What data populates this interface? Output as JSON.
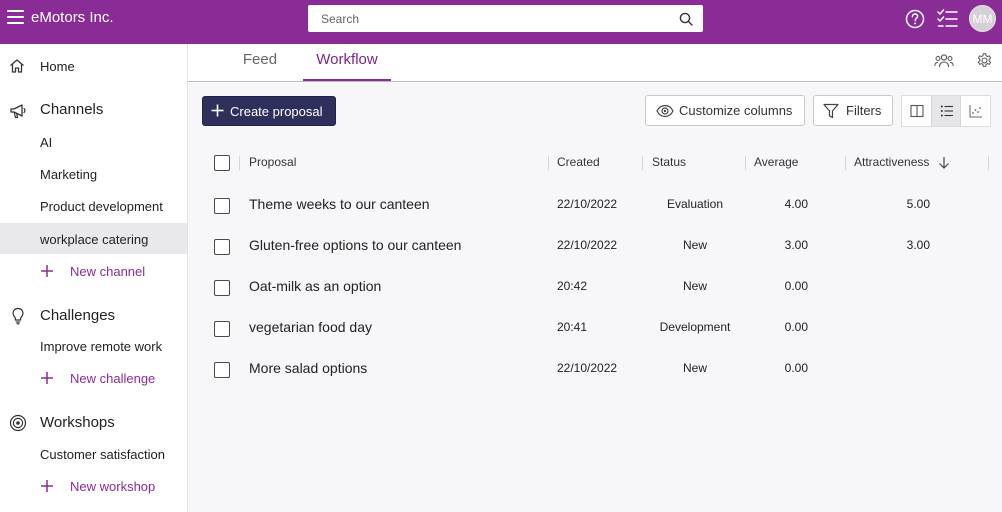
{
  "app": {
    "title": "eMotors Inc."
  },
  "search": {
    "placeholder": "Search"
  },
  "user": {
    "initials": "MM"
  },
  "colors": {
    "brand": "#8a2c96",
    "primary_button": "#2f2f5c",
    "active_tab": "#7b2584",
    "content_bg": "#f7f7f9"
  },
  "sidebar": {
    "home": "Home",
    "channels_title": "Channels",
    "channels": [
      "AI",
      "Marketing",
      "Product development",
      "workplace catering"
    ],
    "active_channel": "workplace catering",
    "new_channel": "New channel",
    "challenges_title": "Challenges",
    "challenges": [
      "Improve remote work"
    ],
    "new_challenge": "New challenge",
    "workshops_title": "Workshops",
    "workshops": [
      "Customer satisfaction"
    ],
    "new_workshop": "New workshop"
  },
  "tabs": [
    {
      "label": "Feed",
      "active": false
    },
    {
      "label": "Workflow",
      "active": true
    }
  ],
  "toolbar": {
    "create_label": "Create proposal",
    "customize_label": "Customize columns",
    "filters_label": "Filters",
    "active_view": "list"
  },
  "table": {
    "columns": {
      "proposal": "Proposal",
      "created": "Created",
      "status": "Status",
      "average": "Average",
      "attractiveness": "Attractiveness"
    },
    "sort": {
      "column": "attractiveness",
      "direction": "descending"
    },
    "rows": [
      {
        "proposal": "Theme weeks to our canteen",
        "created": "22/10/2022",
        "status": "Evaluation",
        "average": "4.00",
        "attractiveness": "5.00"
      },
      {
        "proposal": "Gluten-free options to our canteen",
        "created": "22/10/2022",
        "status": "New",
        "average": "3.00",
        "attractiveness": "3.00"
      },
      {
        "proposal": "Oat-milk as an option",
        "created": "20:42",
        "status": "New",
        "average": "0.00",
        "attractiveness": ""
      },
      {
        "proposal": "vegetarian food day",
        "created": "20:41",
        "status": "Development",
        "average": "0.00",
        "attractiveness": ""
      },
      {
        "proposal": "More salad options",
        "created": "22/10/2022",
        "status": "New",
        "average": "0.00",
        "attractiveness": ""
      }
    ]
  }
}
